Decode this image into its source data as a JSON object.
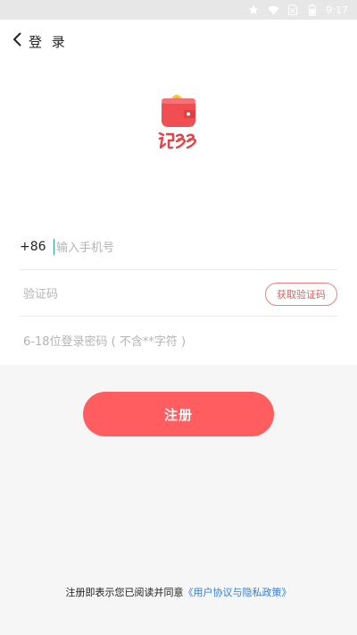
{
  "status_bar": {
    "time": "9:17",
    "icons": [
      "star-icon",
      "wifi-icon",
      "no-sim-icon",
      "battery-icon"
    ]
  },
  "nav": {
    "title": "登 录"
  },
  "form": {
    "country_code": "+86",
    "phone_placeholder": "输入手机号",
    "code_placeholder": "验证码",
    "get_code_label": "获取验证码",
    "password_placeholder": "6-18位登录密码 ( 不含**字符 )"
  },
  "register_label": "注册",
  "agreement": {
    "prefix": "注册即表示您已阅读并同意",
    "link": "《用户协议与隐私政策》"
  },
  "colors": {
    "accent": "#ff5d5f",
    "link": "#2f7fd6",
    "background": "#f6f6f7"
  }
}
